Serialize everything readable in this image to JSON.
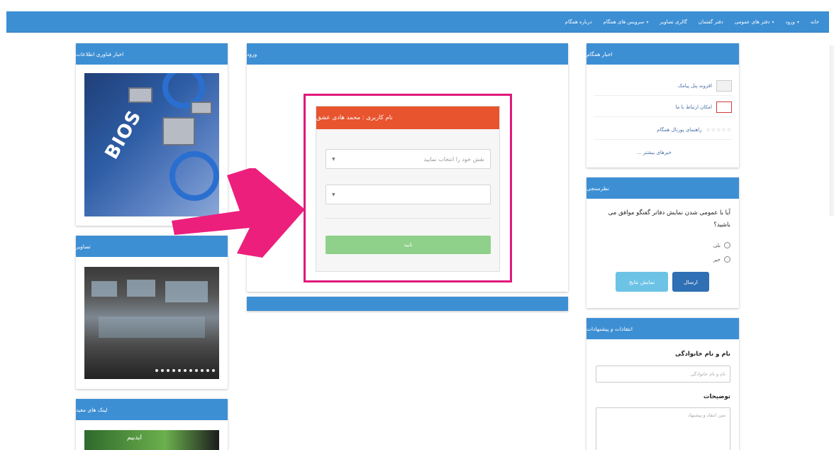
{
  "nav": {
    "items": [
      "خانه",
      "ورود",
      "دفتر های عمومی",
      "دفتر گفتمان",
      "گالری تصاویر",
      "سرویس های همگام",
      "درباره همگام"
    ]
  },
  "left": {
    "tech_news_title": "اخبار فناوری اطلاعات",
    "bios_caption": "BIOS",
    "photos_title": "تصاویر",
    "links_title": "لینک های مفید",
    "ad_caption": "ایدبیم"
  },
  "login": {
    "panel_title": "ورود",
    "card_title": "نام کاربری : محمد هادی عشق",
    "role_placeholder": "نقش خود را انتخاب نمایید",
    "second_placeholder": "",
    "confirm_label": "تایید"
  },
  "news": {
    "title": "اخبار همگام",
    "items": [
      {
        "text": "افزونه پنل پیامک"
      },
      {
        "text": "امکان ارتباط با ما"
      },
      {
        "text": "راهنمای پورتال همگام"
      }
    ],
    "more": "خبرهای بیشتر ..."
  },
  "poll": {
    "title": "نظرسنجی",
    "question": "آیا با عمومی شدن نمایش دفاتر گفتگو موافق می باشید؟",
    "options": [
      "بلی",
      "خیر"
    ],
    "send_label": "ارسال",
    "results_label": "نمایش نتایج"
  },
  "feedback": {
    "title": "انتقادات و پیشنهادات",
    "name_label": "نام و نام خانوادگی",
    "name_placeholder": "نام و نام خانوادگی",
    "desc_label": "توضیحات",
    "desc_placeholder": "متن انتقاد و پیشنهاد"
  },
  "colors": {
    "nav_blue": "#3d8fd4",
    "card_header": "#e8542e",
    "highlight": "#e0197a",
    "confirm_green": "#8fd08a"
  }
}
